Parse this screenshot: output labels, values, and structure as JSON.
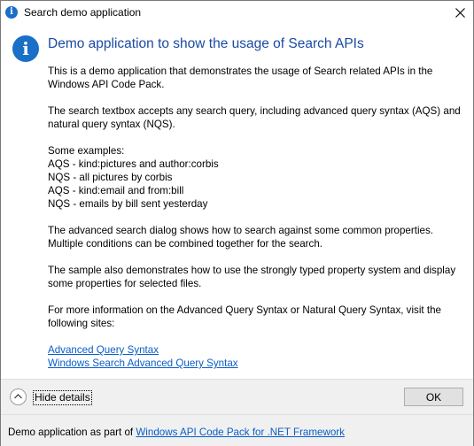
{
  "window": {
    "title": "Search demo application",
    "icon": "info-icon"
  },
  "dialog": {
    "main_instruction": "Demo application to show the usage of Search APIs",
    "paragraphs": {
      "p1": [
        "This is a demo application that demonstrates the usage of Search related APIs in the",
        "Windows API Code Pack."
      ],
      "p2": [
        "The search textbox accepts any search query, including advanced query syntax (AQS) and",
        "natural query syntax (NQS)."
      ],
      "examples_heading": "Some examples:",
      "examples": [
        "AQS - kind:pictures and author:corbis",
        "NQS - all pictures by corbis",
        "AQS - kind:email and from:bill",
        "NQS - emails by bill sent yesterday"
      ],
      "p3": [
        "The advanced search dialog shows how to search against some common properties.",
        "Multiple conditions can be combined together for the search."
      ],
      "p4": [
        "The sample also demonstrates how to use the strongly typed property system and display",
        "some properties for selected files."
      ],
      "p5": [
        "For more information on the Advanced Query Syntax or Natural Query Syntax, visit the",
        "following sites:"
      ]
    },
    "links": [
      "Advanced Query Syntax",
      "Windows Search Advanced Query Syntax"
    ],
    "expando_label": "Hide details",
    "ok_label": "OK",
    "footnote_prefix": "Demo application as part of ",
    "footnote_link": "Windows API Code Pack for .NET Framework"
  },
  "colors": {
    "accent": "#1a6fc7",
    "instruction_text": "#1a4aa3",
    "link": "#0a5ec8"
  }
}
